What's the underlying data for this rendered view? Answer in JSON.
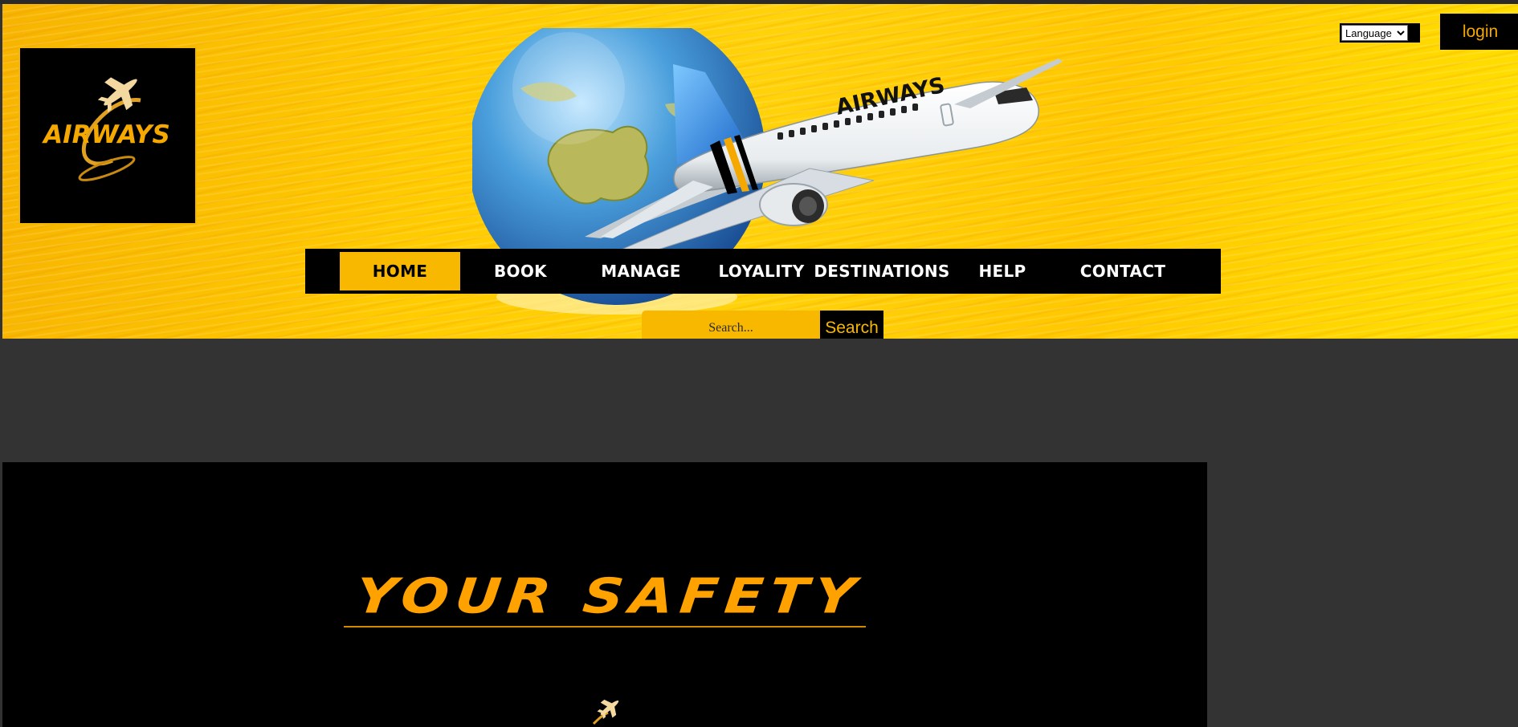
{
  "header": {
    "brand_logo_text": "AIRWAYS",
    "hero_plane_text": "AIRWAYS",
    "language_select": {
      "selected": "Language",
      "options": [
        "Language"
      ]
    },
    "login_label": "login"
  },
  "nav": {
    "items": [
      {
        "label": "HOME",
        "active": true
      },
      {
        "label": "BOOK",
        "active": false
      },
      {
        "label": "MANAGE",
        "active": false
      },
      {
        "label": "LOYALITY",
        "active": false
      },
      {
        "label": "DESTINATIONS",
        "active": false
      },
      {
        "label": "HELP",
        "active": false
      },
      {
        "label": "CONTACT",
        "active": false
      }
    ]
  },
  "search": {
    "placeholder": "Search...",
    "button_label": "Search"
  },
  "hero_section": {
    "headline": "YOUR SAFETY"
  },
  "colors": {
    "accent": "#f9b800",
    "headline": "#ffa200",
    "page_background": "#333333",
    "panel_background": "#000000"
  },
  "icons": [
    "airways-logo",
    "globe-icon",
    "airplane-icon",
    "small-airplane-icon"
  ]
}
